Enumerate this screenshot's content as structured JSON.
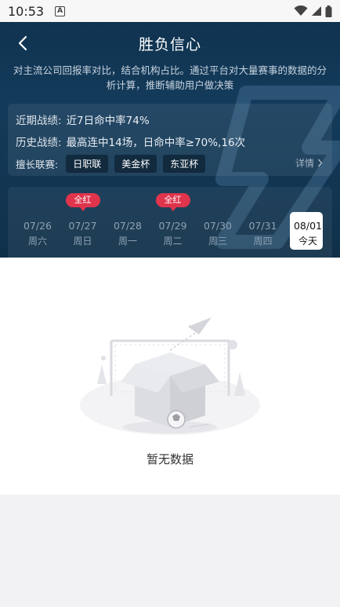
{
  "status_bar": {
    "time": "10:53",
    "indicator": "A"
  },
  "header": {
    "title": "胜负信心"
  },
  "description": "对主流公司回报率对比，结合机构占比。通过平台对大量赛事的数据的分析计算，推断辅助用户做决策",
  "records": {
    "recent_label": "近期战绩:",
    "recent_value": "近7日命中率74%",
    "history_label": "历史战绩:",
    "history_value": "最高连中14场，日命中率≥70%,16次",
    "leagues_label": "擅长联赛:",
    "leagues": [
      "日职联",
      "美金杯",
      "东亚杯"
    ],
    "detail_label": "详情"
  },
  "dates": [
    {
      "md": "07/26",
      "wd": "周六",
      "badge": ""
    },
    {
      "md": "07/27",
      "wd": "周日",
      "badge": "全红"
    },
    {
      "md": "07/28",
      "wd": "周一",
      "badge": ""
    },
    {
      "md": "07/29",
      "wd": "周二",
      "badge": "全红"
    },
    {
      "md": "07/30",
      "wd": "周三",
      "badge": ""
    },
    {
      "md": "07/31",
      "wd": "周四",
      "badge": ""
    },
    {
      "md": "08/01",
      "wd": "今天",
      "badge": "",
      "active": true
    }
  ],
  "empty_state": {
    "text": "暂无数据",
    "icon": "empty-box-soccer-illustration"
  },
  "colors": {
    "accent_red": "#e0344c",
    "hero_bg": "#143b5b"
  }
}
